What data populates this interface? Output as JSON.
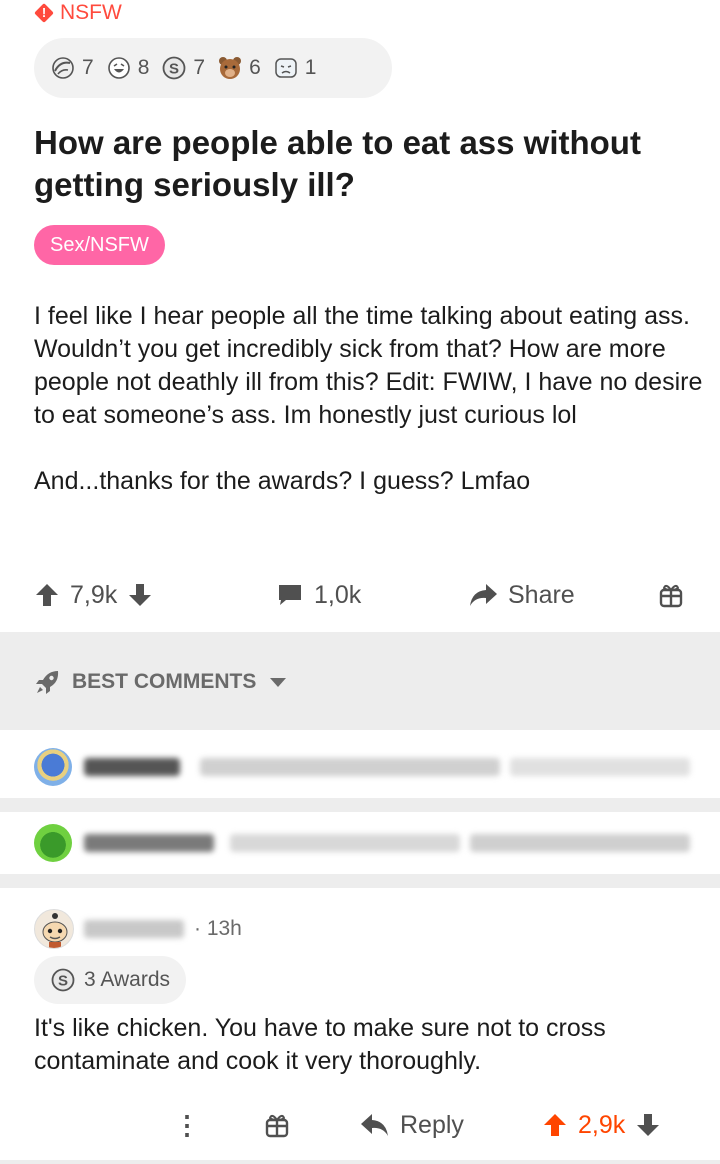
{
  "post": {
    "nsfw_label": "NSFW",
    "awards": [
      {
        "icon": "facepalm-award-icon",
        "count": "7"
      },
      {
        "icon": "laughing-face-award-icon",
        "count": "8"
      },
      {
        "icon": "silver-award-icon",
        "count": "7"
      },
      {
        "icon": "bear-award-icon",
        "count": "6"
      },
      {
        "icon": "sad-face-award-icon",
        "count": "1"
      }
    ],
    "title": "How are people able to eat ass without getting seriously ill?",
    "flair": "Sex/NSFW",
    "body_p1": "I feel like I hear people all the time talking about eating ass. Wouldn’t you get incredibly sick from that? How are more people not deathly ill from this? Edit: FWIW, I have no desire to eat someone’s ass. Im honestly just curious lol",
    "body_p2": "And...thanks for the awards? I guess? Lmfao",
    "upvotes": "7,9k",
    "comments_count": "1,0k",
    "share_label": "Share"
  },
  "sort": {
    "label": "BEST COMMENTS"
  },
  "comment": {
    "time": "· 13h",
    "awards_label": "3 Awards",
    "body": "It's like chicken. You have to make sure not to cross contaminate and cook it very thoroughly.",
    "more_icon": "⋮",
    "reply_label": "Reply",
    "upvotes": "2,9k"
  },
  "colors": {
    "nsfw": "#ff4a3d",
    "flair_bg": "#ff66a6",
    "upvoted": "#ff4500",
    "muted": "#505050"
  }
}
